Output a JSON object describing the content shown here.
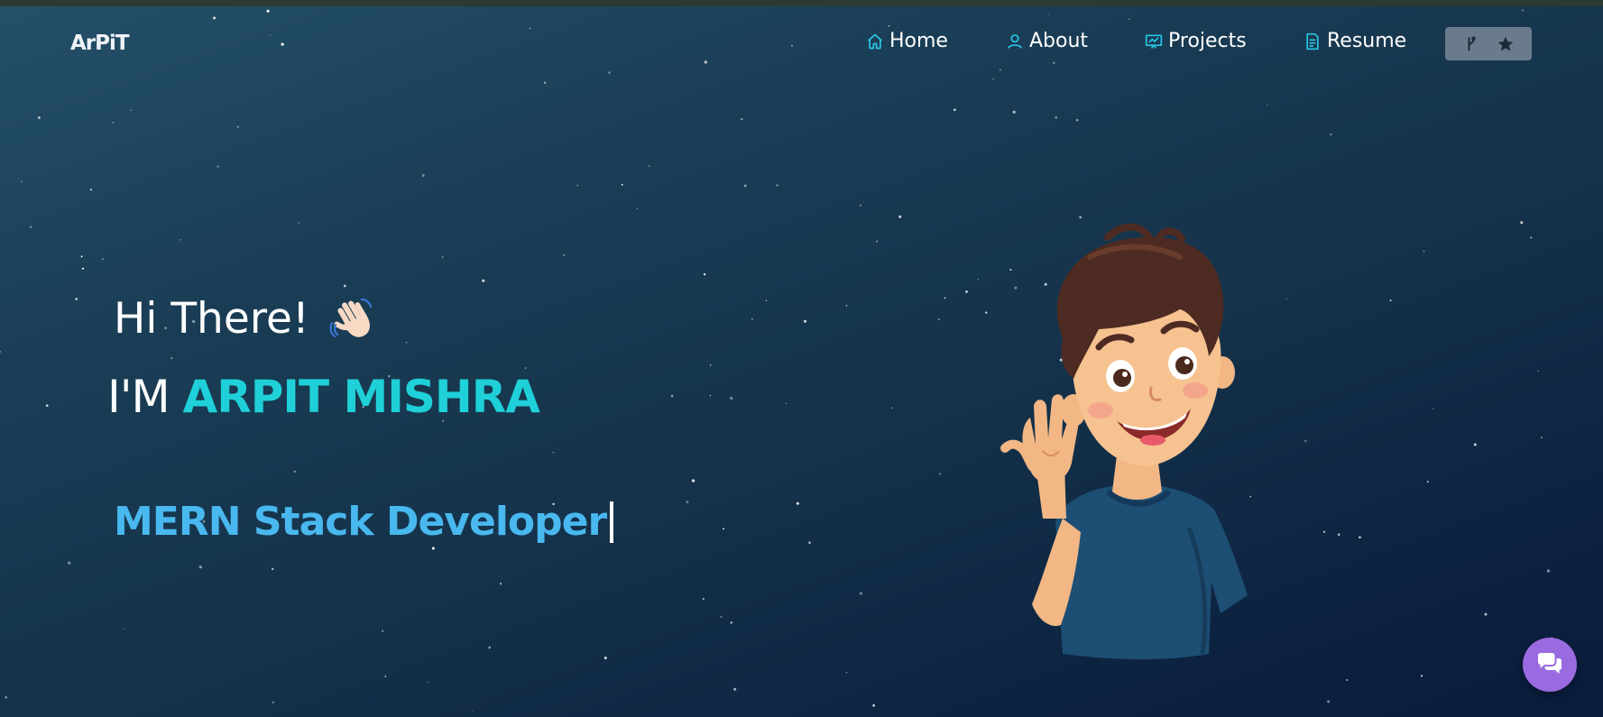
{
  "brand": {
    "logo": "ArPiT"
  },
  "nav": {
    "items": [
      {
        "label": "Home",
        "icon": "home-icon"
      },
      {
        "label": "About",
        "icon": "user-icon"
      },
      {
        "label": "Projects",
        "icon": "presentation-icon"
      },
      {
        "label": "Resume",
        "icon": "document-icon"
      }
    ],
    "github_button": {
      "icons": [
        "fork-icon",
        "star-icon"
      ]
    }
  },
  "hero": {
    "greeting": "Hi There!",
    "greeting_emoji": "waving-hand-icon",
    "name_prefix": "I'M",
    "name": "ARPIT MISHRA",
    "role": "MERN Stack Developer"
  },
  "chat": {
    "icon": "chat-icon"
  },
  "colors": {
    "accent_name": "#1fd0d8",
    "accent_role": "#49b8ee",
    "nav_icon": "#29c6e6",
    "chat_button": "#9a6be0",
    "github_button_bg": "#6a7c8c"
  }
}
